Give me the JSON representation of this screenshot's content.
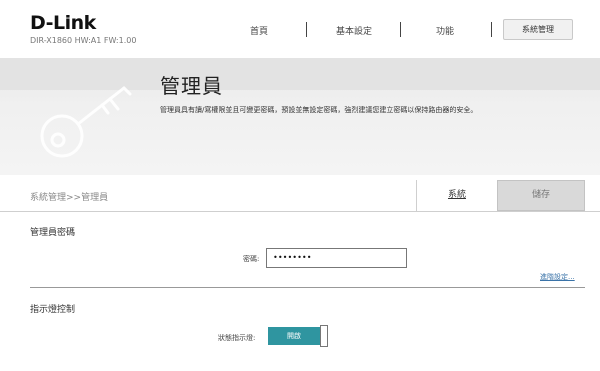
{
  "header": {
    "logo": "D-Link",
    "model": "DIR-X1860 HW:A1 FW:1.00",
    "nav": [
      {
        "label": "首頁"
      },
      {
        "label": "基本設定"
      },
      {
        "label": "功能"
      },
      {
        "label": "系統管理"
      }
    ]
  },
  "hero": {
    "icon": "key-icon",
    "title": "管理員",
    "description": "管理員具有讀/寫權限並且可變更密碼，預設並無設定密碼，強烈建議您建立密碼以保持路由器的安全。"
  },
  "toolbar": {
    "breadcrumb": "系統管理>>管理員",
    "system_tab": "系統",
    "save_label": "儲存"
  },
  "admin_password": {
    "section_title": "管理員密碼",
    "password_label": "密碼:",
    "password_value": "••••••••",
    "advanced_link": "進階設定..."
  },
  "led_control": {
    "section_title": "指示燈控制",
    "status_label": "狀態指示燈:",
    "toggle_label": "開啟",
    "toggle_state": "on"
  },
  "colors": {
    "accent": "#2f95a0",
    "link": "#3a73a8",
    "hero_bg": "#eeeeee"
  }
}
